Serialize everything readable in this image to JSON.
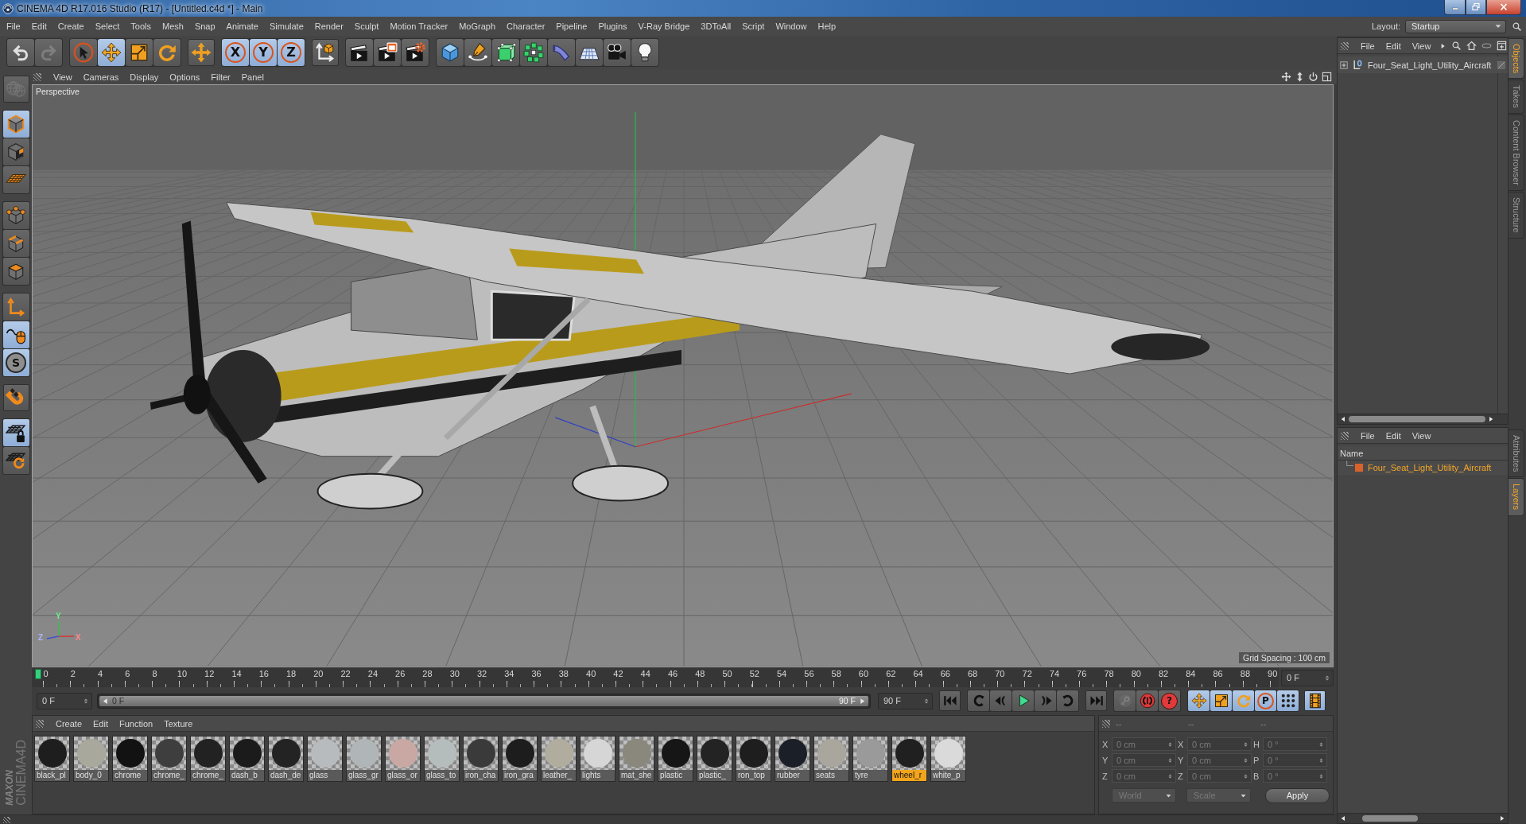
{
  "window": {
    "title": "CINEMA 4D R17.016 Studio (R17) - [Untitled.c4d *] - Main"
  },
  "menu_bar": {
    "items": [
      "File",
      "Edit",
      "Create",
      "Select",
      "Tools",
      "Mesh",
      "Snap",
      "Animate",
      "Simulate",
      "Render",
      "Sculpt",
      "Motion Tracker",
      "MoGraph",
      "Character",
      "Pipeline",
      "Plugins",
      "V-Ray Bridge",
      "3DToAll",
      "Script",
      "Window",
      "Help"
    ],
    "layout_label": "Layout:",
    "layout_value": "Startup"
  },
  "toolbar": {
    "groups": [
      [
        {
          "kind": "icon",
          "active": false,
          "disabled": false
        },
        {
          "kind": "icon",
          "active": false,
          "disabled": true
        }
      ],
      [
        {
          "kind": "icon",
          "active": false,
          "disabled": false
        },
        {
          "kind": "icon",
          "active": true,
          "disabled": false
        },
        {
          "kind": "icon",
          "active": false,
          "disabled": false
        },
        {
          "kind": "icon",
          "active": false,
          "disabled": false
        }
      ],
      [
        {
          "kind": "icon",
          "active": false,
          "disabled": false
        }
      ],
      [
        {
          "kind": "letter",
          "label": "X",
          "active": true,
          "disabled": false
        },
        {
          "kind": "letter",
          "label": "Y",
          "active": true,
          "disabled": false
        },
        {
          "kind": "letter",
          "label": "Z",
          "active": true,
          "disabled": false
        }
      ],
      [
        {
          "kind": "icon",
          "active": false,
          "disabled": false
        }
      ],
      [
        {
          "kind": "icon",
          "active": false,
          "disabled": false
        },
        {
          "kind": "icon",
          "active": false,
          "disabled": false
        },
        {
          "kind": "icon",
          "active": false,
          "disabled": false
        }
      ],
      [
        {
          "kind": "icon",
          "active": false,
          "disabled": false
        },
        {
          "kind": "icon",
          "active": false,
          "disabled": false
        },
        {
          "kind": "icon",
          "active": false,
          "disabled": false
        },
        {
          "kind": "icon",
          "active": false,
          "disabled": false
        },
        {
          "kind": "icon",
          "active": false,
          "disabled": false
        },
        {
          "kind": "icon",
          "active": false,
          "disabled": false
        },
        {
          "kind": "icon",
          "active": false,
          "disabled": false
        },
        {
          "kind": "icon",
          "active": false,
          "disabled": false
        }
      ]
    ]
  },
  "left_toolbar": {
    "groups": [
      [
        {
          "kind": "icon",
          "active": false,
          "disabled": true
        }
      ],
      [
        {
          "kind": "icon",
          "active": true,
          "disabled": false
        },
        {
          "kind": "icon",
          "active": false,
          "disabled": false
        },
        {
          "kind": "icon",
          "active": false,
          "disabled": false
        }
      ],
      [
        {
          "kind": "icon",
          "active": false,
          "disabled": false
        },
        {
          "kind": "icon",
          "active": false,
          "disabled": false
        },
        {
          "kind": "icon",
          "active": false,
          "disabled": false
        }
      ],
      [
        {
          "kind": "icon",
          "active": false,
          "disabled": false
        },
        {
          "kind": "icon",
          "active": true,
          "disabled": false
        },
        {
          "kind": "letter",
          "label": "S",
          "active": true,
          "disabled": false
        }
      ],
      [
        {
          "kind": "icon",
          "active": false,
          "disabled": false
        }
      ],
      [
        {
          "kind": "icon",
          "active": true,
          "disabled": false
        },
        {
          "kind": "icon",
          "active": false,
          "disabled": false
        }
      ]
    ]
  },
  "viewport": {
    "menu": [
      "View",
      "Cameras",
      "Display",
      "Options",
      "Filter",
      "Panel"
    ],
    "camera": "Perspective",
    "grid_spacing": "Grid Spacing : 100 cm",
    "axis_labels": [
      "Y",
      "Z",
      "X"
    ]
  },
  "timeline": {
    "ticks": [
      "0",
      "2",
      "4",
      "6",
      "8",
      "10",
      "12",
      "14",
      "16",
      "18",
      "20",
      "22",
      "24",
      "26",
      "28",
      "30",
      "32",
      "34",
      "36",
      "38",
      "40",
      "42",
      "44",
      "46",
      "48",
      "50",
      "52",
      "54",
      "56",
      "58",
      "60",
      "62",
      "64",
      "66",
      "68",
      "70",
      "72",
      "74",
      "76",
      "78",
      "80",
      "82",
      "84",
      "86",
      "88",
      "90"
    ],
    "playhead": {
      "level": 0
    },
    "current_frame": "0 F"
  },
  "transport": {
    "start_frame": "0 F",
    "range": {
      "start": "0 F",
      "end": "90 F",
      "level": 1
    },
    "end_frame": "90 F",
    "groups": [
      [
        {
          "kind": "icon",
          "active": false,
          "disabled": false
        }
      ],
      [
        {
          "kind": "icon",
          "active": false,
          "disabled": false
        },
        {
          "kind": "icon",
          "active": false,
          "disabled": false
        },
        {
          "kind": "icon",
          "active": false,
          "disabled": false
        },
        {
          "kind": "icon",
          "active": false,
          "disabled": false
        },
        {
          "kind": "icon",
          "active": false,
          "disabled": false
        }
      ],
      [
        {
          "kind": "icon",
          "active": false,
          "disabled": false
        }
      ],
      [
        {
          "kind": "icon",
          "active": false,
          "disabled": true
        },
        {
          "kind": "icon",
          "active": false,
          "disabled": false
        },
        {
          "kind": "letter",
          "label": "?",
          "active": false,
          "disabled": false
        }
      ],
      [
        {
          "kind": "icon",
          "active": true,
          "disabled": false
        },
        {
          "kind": "icon",
          "active": true,
          "disabled": false
        },
        {
          "kind": "icon",
          "active": true,
          "disabled": false
        },
        {
          "kind": "letter",
          "label": "P",
          "active": true,
          "disabled": false
        },
        {
          "kind": "icon",
          "active": true,
          "disabled": false
        }
      ],
      [
        {
          "kind": "icon",
          "active": true,
          "disabled": false
        }
      ]
    ]
  },
  "material_manager": {
    "menu": [
      "Create",
      "Edit",
      "Function",
      "Texture"
    ],
    "materials": [
      {
        "name": "black_pl",
        "color": "#1e1e1e",
        "selected": false
      },
      {
        "name": "body_0",
        "color": "#a9a89c",
        "selected": false
      },
      {
        "name": "chrome",
        "color": "#121212",
        "selected": false
      },
      {
        "name": "chrome_",
        "color": "#3e3e3e",
        "selected": false
      },
      {
        "name": "chrome_",
        "color": "#222222",
        "selected": false
      },
      {
        "name": "dash_b",
        "color": "#1b1b1b",
        "selected": false
      },
      {
        "name": "dash_de",
        "color": "#232323",
        "selected": false
      },
      {
        "name": "glass",
        "color": "#b8bbbe",
        "selected": false
      },
      {
        "name": "glass_gr",
        "color": "#b0b6b8",
        "selected": false
      },
      {
        "name": "glass_or",
        "color": "#c9a8a4",
        "selected": false
      },
      {
        "name": "glass_to",
        "color": "#b4bcbc",
        "selected": false
      },
      {
        "name": "iron_cha",
        "color": "#3a3a3a",
        "selected": false
      },
      {
        "name": "iron_gra",
        "color": "#1d1d1d",
        "selected": false
      },
      {
        "name": "leather_",
        "color": "#b0ad9e",
        "selected": false
      },
      {
        "name": "lights",
        "color": "#d6d6d6",
        "selected": false
      },
      {
        "name": "mat_she",
        "color": "#8a877c",
        "selected": false
      },
      {
        "name": "plastic",
        "color": "#161616",
        "selected": false
      },
      {
        "name": "plastic_",
        "color": "#232323",
        "selected": false
      },
      {
        "name": "ron_top",
        "color": "#1e1e1e",
        "selected": false
      },
      {
        "name": "rubber",
        "color": "#1b1f27",
        "selected": false
      },
      {
        "name": "seats",
        "color": "#a9a79d",
        "selected": false
      },
      {
        "name": "tyre",
        "color": "#9a9a9a",
        "selected": false
      },
      {
        "name": "wheel_r",
        "color": "#202020",
        "selected": true
      },
      {
        "name": "white_p",
        "color": "#dadada",
        "selected": false
      }
    ]
  },
  "logo": {
    "brand": "MAXON",
    "product": "CINEMA4D"
  },
  "coordinates": {
    "headers": [
      "--",
      "--",
      "--"
    ],
    "disabled": true,
    "rows": [
      {
        "cells": [
          {
            "axis": "X",
            "value": "0 cm"
          },
          {
            "axis": "X",
            "value": "0 cm"
          },
          {
            "axis": "H",
            "value": "0 °"
          }
        ]
      },
      {
        "cells": [
          {
            "axis": "Y",
            "value": "0 cm"
          },
          {
            "axis": "Y",
            "value": "0 cm"
          },
          {
            "axis": "P",
            "value": "0 °"
          }
        ]
      },
      {
        "cells": [
          {
            "axis": "Z",
            "value": "0 cm"
          },
          {
            "axis": "Z",
            "value": "0 cm"
          },
          {
            "axis": "B",
            "value": "0 °"
          }
        ]
      }
    ],
    "space": "World",
    "mode": "Scale",
    "apply": "Apply"
  },
  "object_manager": {
    "menu": [
      "File",
      "Edit",
      "View"
    ],
    "objects": [
      {
        "name": "Four_Seat_Light_Utility_Aircraft",
        "expanded": false
      }
    ]
  },
  "layer_manager": {
    "menu": [
      "File",
      "Edit",
      "View"
    ],
    "column": "Name",
    "layers": [
      {
        "name": "Four_Seat_Light_Utility_Aircraft",
        "color": "#d9622b",
        "selected": true
      }
    ]
  },
  "side_tabs": {
    "upper": [
      {
        "label": "Objects",
        "selected": true
      },
      {
        "label": "Takes",
        "selected": false
      },
      {
        "label": "Content Browser",
        "selected": false
      },
      {
        "label": "Structure",
        "selected": false
      }
    ],
    "lower": [
      {
        "label": "Attributes",
        "selected": false
      },
      {
        "label": "Layers",
        "selected": true
      }
    ]
  }
}
